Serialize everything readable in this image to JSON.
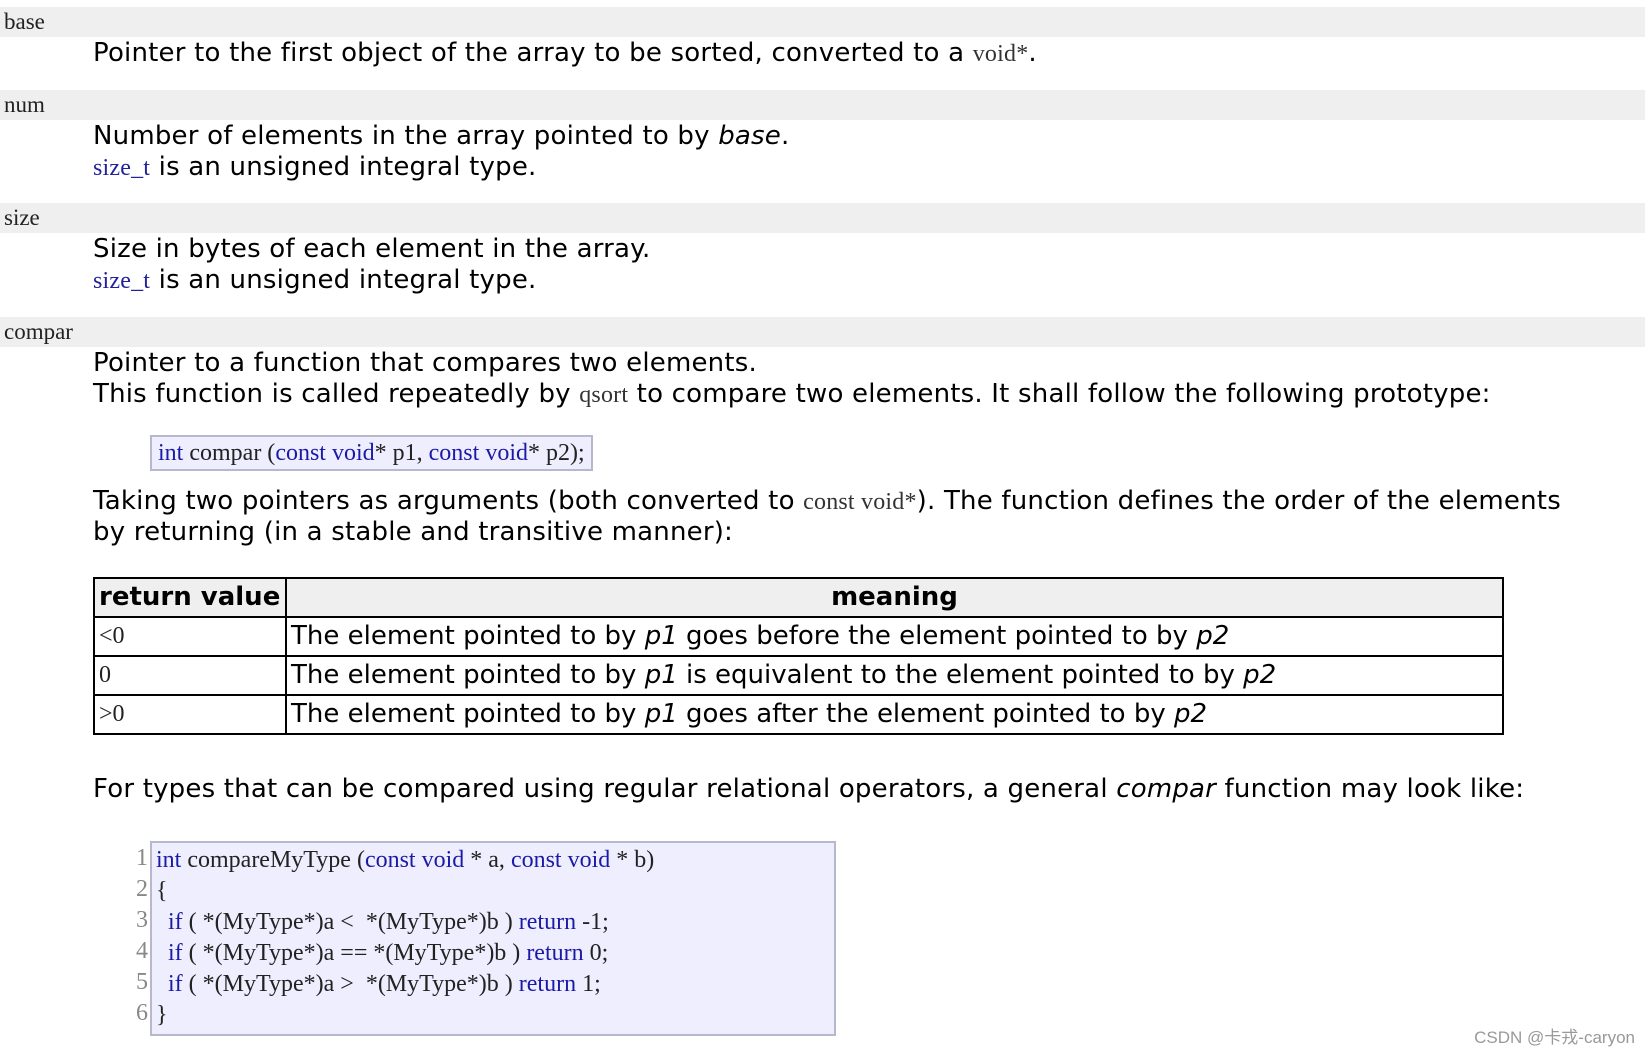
{
  "params": {
    "base": {
      "name": "base",
      "desc_pre": "Pointer to the first object of the array to be sorted, converted to a ",
      "desc_code": "void*",
      "desc_post": "."
    },
    "num": {
      "name": "num",
      "desc_pre": "Number of elements in the array pointed to by ",
      "desc_em": "base",
      "desc_post": ".",
      "type_link": "size_t",
      "type_note": " is an unsigned integral type."
    },
    "size": {
      "name": "size",
      "desc": "Size in bytes of each element in the array.",
      "type_link": "size_t",
      "type_note": " is an unsigned integral type."
    },
    "compar": {
      "name": "compar",
      "line1": "Pointer to a function that compares two elements.",
      "line2_pre": "This function is called repeatedly by ",
      "line2_code": "qsort",
      "line2_post": " to compare two elements. It shall follow the following prototype:",
      "prototype": {
        "kw_int": "int",
        "name": " compar (",
        "kw_const1": "const",
        "sp1": " ",
        "kw_void1": "void",
        "p1": "* p1, ",
        "kw_const2": "const",
        "sp2": " ",
        "kw_void2": "void",
        "p2": "* p2);"
      },
      "para_pre": "Taking two pointers as arguments (both converted to ",
      "para_code": "const void*",
      "para_post": "). The function defines the order of the elements",
      "para_line2": "by returning (in a stable and transitive manner):"
    }
  },
  "table": {
    "headers": [
      "return value",
      "meaning"
    ],
    "rows": [
      {
        "value": "<0",
        "pre": "The element pointed to by ",
        "a": "p1",
        "mid": " goes before the element pointed to by ",
        "b": "p2"
      },
      {
        "value": "0",
        "pre": "The element pointed to by ",
        "a": "p1",
        "mid": " is equivalent to the element pointed to by ",
        "b": "p2"
      },
      {
        "value": ">0",
        "pre": "The element pointed to by ",
        "a": "p1",
        "mid": " goes after the element pointed to by ",
        "b": "p2"
      }
    ]
  },
  "general": {
    "pre": "For types that can be compared using regular relational operators, a general ",
    "em": "compar",
    "post": " function may look like:"
  },
  "code": {
    "line_numbers": [
      "1",
      "2",
      "3",
      "4",
      "5",
      "6"
    ],
    "lines": [
      {
        "k1": "int",
        "t1": " compareMyType (",
        "k2": "const",
        "s2": " ",
        "k3": "void",
        "t2": " * a, ",
        "k4": "const",
        "s4": " ",
        "k5": "void",
        "t3": " * b)"
      },
      {
        "t1": "{"
      },
      {
        "t0": "  ",
        "k1": "if",
        "t1": " ( *(MyType*)a <  *(MyType*)b ) ",
        "k2": "return",
        "t2": " -1;"
      },
      {
        "t0": "  ",
        "k1": "if",
        "t1": " ( *(MyType*)a == *(MyType*)b ) ",
        "k2": "return",
        "t2": " 0;"
      },
      {
        "t0": "  ",
        "k1": "if",
        "t1": " ( *(MyType*)a >  *(MyType*)b ) ",
        "k2": "return",
        "t2": " 1;"
      },
      {
        "t1": "}"
      }
    ]
  },
  "watermark": "CSDN @卡戎-caryon",
  "colors": {
    "keyword": "#1a1aa6",
    "code_bg": "#eeeeff",
    "header_bg": "#efefef"
  }
}
